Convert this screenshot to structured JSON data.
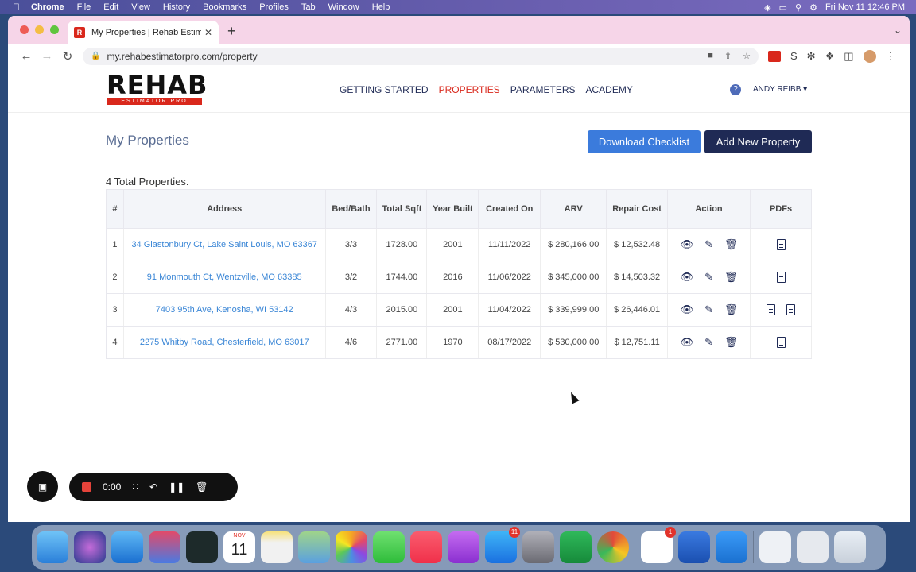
{
  "menubar": {
    "app": "Chrome",
    "items": [
      "File",
      "Edit",
      "View",
      "History",
      "Bookmarks",
      "Profiles",
      "Tab",
      "Window",
      "Help"
    ],
    "clock": "Fri Nov 11  12:46 PM"
  },
  "browser": {
    "tab_title": "My Properties | Rehab Estimato",
    "url": "my.rehabestimatorpro.com/property"
  },
  "site": {
    "logo_word": "REHAB",
    "logo_sub": "ESTIMATOR PRO",
    "nav": [
      "GETTING STARTED",
      "PROPERTIES",
      "PARAMETERS",
      "ACADEMY"
    ],
    "user": "ANDY REIBB ▾"
  },
  "page": {
    "title": "My Properties",
    "download_label": "Download Checklist",
    "add_label": "Add New Property",
    "total": "4 Total Properties."
  },
  "table": {
    "headers": [
      "#",
      "Address",
      "Bed/Bath",
      "Total Sqft",
      "Year Built",
      "Created On",
      "ARV",
      "Repair Cost",
      "Action",
      "PDFs"
    ],
    "rows": [
      {
        "num": "1",
        "address": "34 Glastonbury Ct, Lake Saint Louis, MO 63367",
        "bedbath": "3/3",
        "sqft": "1728.00",
        "year": "2001",
        "created": "11/11/2022",
        "arv": "$ 280,166.00",
        "repair": "$ 12,532.48",
        "pdf_count": 1
      },
      {
        "num": "2",
        "address": "91 Monmouth Ct, Wentzville, MO 63385",
        "bedbath": "3/2",
        "sqft": "1744.00",
        "year": "2016",
        "created": "11/06/2022",
        "arv": "$ 345,000.00",
        "repair": "$ 14,503.32",
        "pdf_count": 1
      },
      {
        "num": "3",
        "address": "7403 95th Ave, Kenosha, WI 53142",
        "bedbath": "4/3",
        "sqft": "2015.00",
        "year": "2001",
        "created": "11/04/2022",
        "arv": "$ 339,999.00",
        "repair": "$ 26,446.01",
        "pdf_count": 2
      },
      {
        "num": "4",
        "address": "2275 Whitby Road, Chesterfield, MO 63017",
        "bedbath": "4/6",
        "sqft": "2771.00",
        "year": "1970",
        "created": "08/17/2022",
        "arv": "$ 530,000.00",
        "repair": "$ 12,751.11",
        "pdf_count": 1
      }
    ]
  },
  "recorder": {
    "time": "0:00"
  },
  "dock": {
    "calendar_month": "NOV",
    "calendar_day": "11",
    "appstore_badge": "11",
    "slack_badge": "1"
  }
}
